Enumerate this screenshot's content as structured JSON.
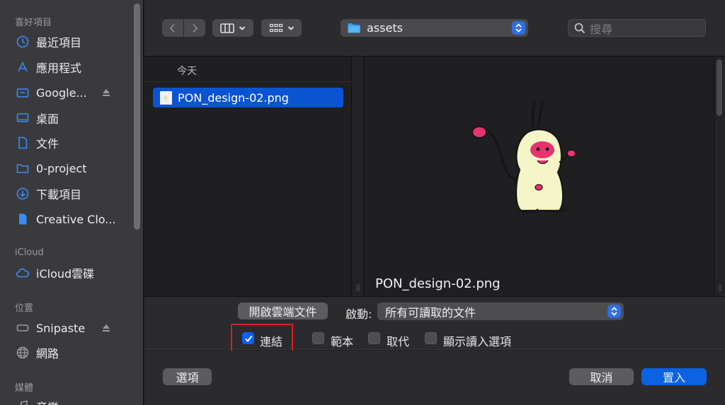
{
  "sidebar": {
    "sections": [
      {
        "title": "喜好項目"
      },
      {
        "title": "iCloud"
      },
      {
        "title": "位置"
      },
      {
        "title": "媒體"
      }
    ],
    "favorites": [
      {
        "label": "最近項目",
        "icon": "clock-icon"
      },
      {
        "label": "應用程式",
        "icon": "applications-icon"
      },
      {
        "label": "Google...",
        "icon": "drive-icon",
        "eject": true
      },
      {
        "label": "桌面",
        "icon": "desktop-icon"
      },
      {
        "label": "文件",
        "icon": "document-icon"
      },
      {
        "label": "0-project",
        "icon": "folder-icon"
      },
      {
        "label": "下載項目",
        "icon": "download-icon"
      },
      {
        "label": "Creative Clo...",
        "icon": "file-icon"
      }
    ],
    "icloud": [
      {
        "label": "iCloud雲碟",
        "icon": "cloud-icon"
      }
    ],
    "locations": [
      {
        "label": "Snipaste",
        "icon": "drive-icon",
        "eject": true
      },
      {
        "label": "網路",
        "icon": "globe-icon"
      }
    ],
    "media": [
      {
        "label": "音樂",
        "icon": "music-icon"
      }
    ]
  },
  "toolbar": {
    "location": "assets",
    "search_placeholder": "搜尋"
  },
  "browser": {
    "group_header": "今天",
    "files": [
      {
        "name": "PON_design-02.png",
        "selected": true
      }
    ],
    "preview_name": "PON_design-02.png"
  },
  "options": {
    "open_cloud_button": "開啟雲端文件",
    "enable_label": "啟動:",
    "enable_value": "所有可讀取的文件",
    "checkboxes": [
      {
        "label": "連結",
        "checked": true
      },
      {
        "label": "範本",
        "checked": false
      },
      {
        "label": "取代",
        "checked": false
      },
      {
        "label": "顯示讀入選項",
        "checked": false
      }
    ]
  },
  "footer": {
    "options_button": "選項",
    "cancel_button": "取消",
    "insert_button": "置入"
  },
  "colors": {
    "accent": "#0b62e3",
    "selection": "#0b54d1",
    "highlight_box": "#e01b24"
  }
}
